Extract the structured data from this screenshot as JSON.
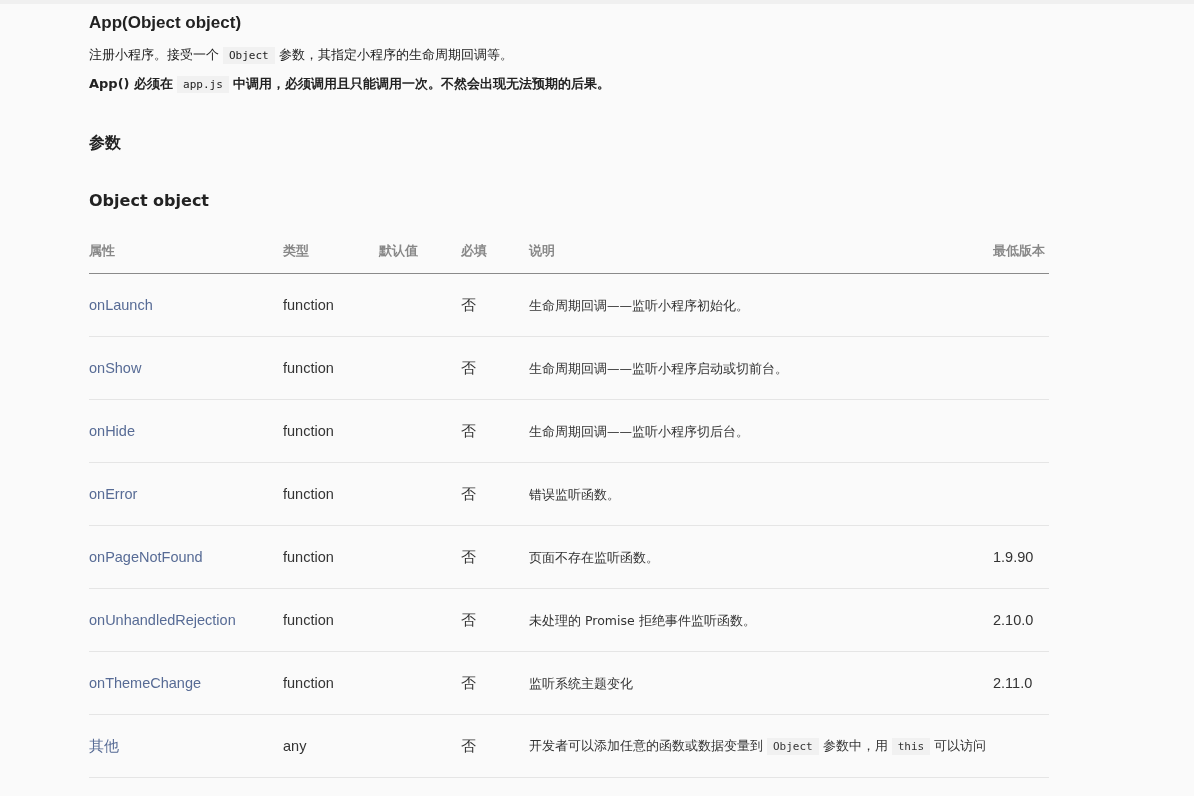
{
  "title": "App(Object object)",
  "intro": [
    {
      "kind": "text",
      "text": "注册小程序。接受一个"
    },
    {
      "kind": "code",
      "text": "Object"
    },
    {
      "kind": "text",
      "text": "参数，其指定小程序的生命周期回调等。"
    }
  ],
  "warning": [
    {
      "kind": "text",
      "text": "App() 必须在"
    },
    {
      "kind": "code",
      "text": "app.js"
    },
    {
      "kind": "text",
      "text": "中调用，必须调用且只能调用一次。不然会出现无法预期的后果。"
    }
  ],
  "params_heading": "参数",
  "object_heading": "Object object",
  "table": {
    "columns": [
      "属性",
      "类型",
      "默认值",
      "必填",
      "说明",
      "最低版本"
    ],
    "rows": [
      {
        "name": "onLaunch",
        "type": "function",
        "required": "否",
        "desc": [
          {
            "kind": "text",
            "text": "生命周期回调——监听小程序初始化。"
          }
        ],
        "version": ""
      },
      {
        "name": "onShow",
        "type": "function",
        "required": "否",
        "desc": [
          {
            "kind": "text",
            "text": "生命周期回调——监听小程序启动或切前台。"
          }
        ],
        "version": ""
      },
      {
        "name": "onHide",
        "type": "function",
        "required": "否",
        "desc": [
          {
            "kind": "text",
            "text": "生命周期回调——监听小程序切后台。"
          }
        ],
        "version": ""
      },
      {
        "name": "onError",
        "type": "function",
        "required": "否",
        "desc": [
          {
            "kind": "text",
            "text": "错误监听函数。"
          }
        ],
        "version": ""
      },
      {
        "name": "onPageNotFound",
        "type": "function",
        "required": "否",
        "desc": [
          {
            "kind": "text",
            "text": "页面不存在监听函数。"
          }
        ],
        "version": "1.9.90"
      },
      {
        "name": "onUnhandledRejection",
        "type": "function",
        "required": "否",
        "desc": [
          {
            "kind": "text",
            "text": "未处理的 Promise 拒绝事件监听函数。"
          }
        ],
        "version": "2.10.0"
      },
      {
        "name": "onThemeChange",
        "type": "function",
        "required": "否",
        "desc": [
          {
            "kind": "text",
            "text": "监听系统主题变化"
          }
        ],
        "version": "2.11.0"
      },
      {
        "name": "其他",
        "type": "any",
        "required": "否",
        "desc": [
          {
            "kind": "text",
            "text": "开发者可以添加任意的函数或数据变量到"
          },
          {
            "kind": "code",
            "text": "Object"
          },
          {
            "kind": "text",
            "text": "参数中，用"
          },
          {
            "kind": "code",
            "text": "this"
          },
          {
            "kind": "text",
            "text": "可以访问"
          }
        ],
        "version": ""
      }
    ]
  }
}
